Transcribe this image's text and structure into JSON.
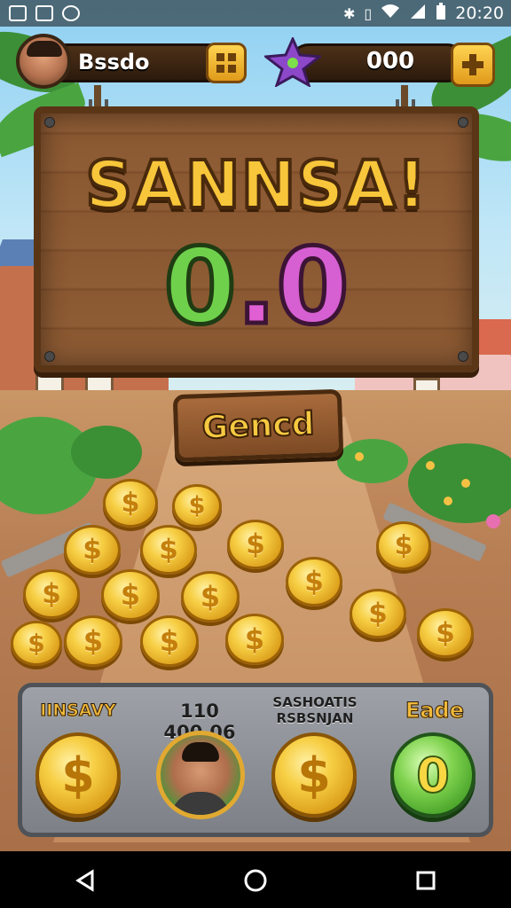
{
  "status_bar": {
    "time": "20:20",
    "left_icons": [
      "gallery-icon",
      "photo-icon",
      "alarm-icon"
    ],
    "right_icons": [
      "bluetooth-icon",
      "sim-icon",
      "wifi-icon",
      "signal-icon",
      "battery-icon"
    ]
  },
  "player": {
    "name": "Bssdo",
    "gem_count": "000"
  },
  "sign": {
    "title": "SANNSA!",
    "score_left": "0",
    "score_dot": ".",
    "score_right": "0"
  },
  "generate_button": {
    "label": "Gencd"
  },
  "bottom_panel": {
    "label_a": "IINSAVY",
    "label_b": "110 400,06",
    "label_c_line1": "SASHOATIS",
    "label_c_line2": "RSBSNJAN",
    "label_d": "Eade",
    "green_coin_symbol": "0"
  },
  "coin_symbol": "$",
  "colors": {
    "gold": "#f7cf45",
    "wood": "#8e5c35",
    "score_green": "#6fd14b",
    "score_pink": "#d65fd2",
    "panel": "#9ea2a8"
  }
}
